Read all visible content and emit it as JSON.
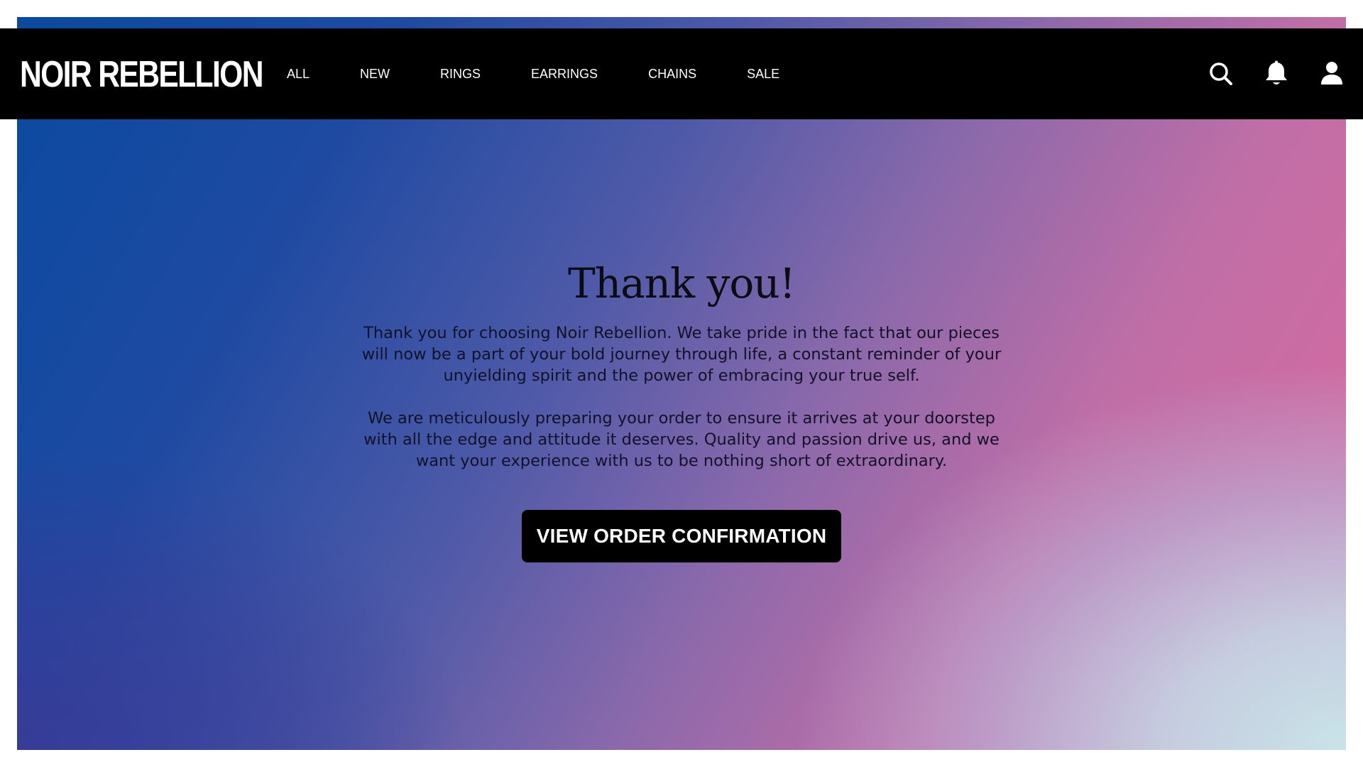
{
  "brand": {
    "logo_text": "NOIR REBELLION"
  },
  "nav": {
    "links": [
      "ALL",
      "NEW",
      "RINGS",
      "EARRINGS",
      "CHAINS",
      "SALE"
    ],
    "icons": [
      "search-icon",
      "bell-icon",
      "user-icon"
    ]
  },
  "main": {
    "title": "Thank you!",
    "paragraph_1": "Thank you for choosing Noir Rebellion. We take pride in the fact that our pieces will now be a part of your bold journey through life, a constant reminder of your unyielding spirit and the power of embracing your true self.",
    "paragraph_2": "We are meticulously preparing your order to ensure it arrives at your doorstep with all the edge and attitude it deserves. Quality and passion drive us, and we want your experience with us to be nothing short of extraordinary.",
    "cta_label": "VIEW ORDER CONFIRMATION"
  },
  "colors": {
    "navbar_bg": "#000000",
    "gradient_blue": "#0a4aa0",
    "gradient_pink": "#dc6aa0",
    "gradient_light": "#c8e4e8",
    "button_bg": "#000000",
    "button_text": "#ffffff"
  }
}
